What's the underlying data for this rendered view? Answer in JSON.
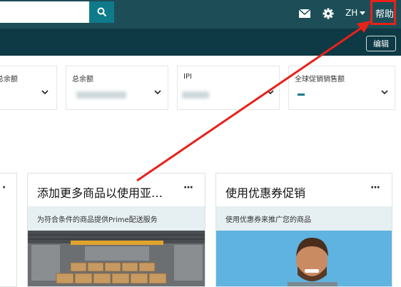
{
  "topbar": {
    "search_icon": "search-icon",
    "mail_icon": "mail-icon",
    "gear_icon": "gear-icon",
    "language": "ZH",
    "help_label": "帮助"
  },
  "subbar": {
    "edit_label": "编辑"
  },
  "metrics": [
    {
      "label": "总余额"
    },
    {
      "label": "总余额"
    },
    {
      "label": "IPI"
    },
    {
      "label": "全球促销销售额"
    }
  ],
  "cards": [
    {
      "title": "添加更多商品以使用亚…",
      "more": "···",
      "subtitle": "为符合条件的商品提供Prime配送服务"
    },
    {
      "title": "使用优惠券促销",
      "more": "···",
      "subtitle": "使用优惠券来推广您的商品"
    }
  ],
  "colors": {
    "header": "#1d4e57",
    "subheader": "#0d3a44",
    "accent": "#0e7a8a",
    "annotation": "#e8211a"
  }
}
